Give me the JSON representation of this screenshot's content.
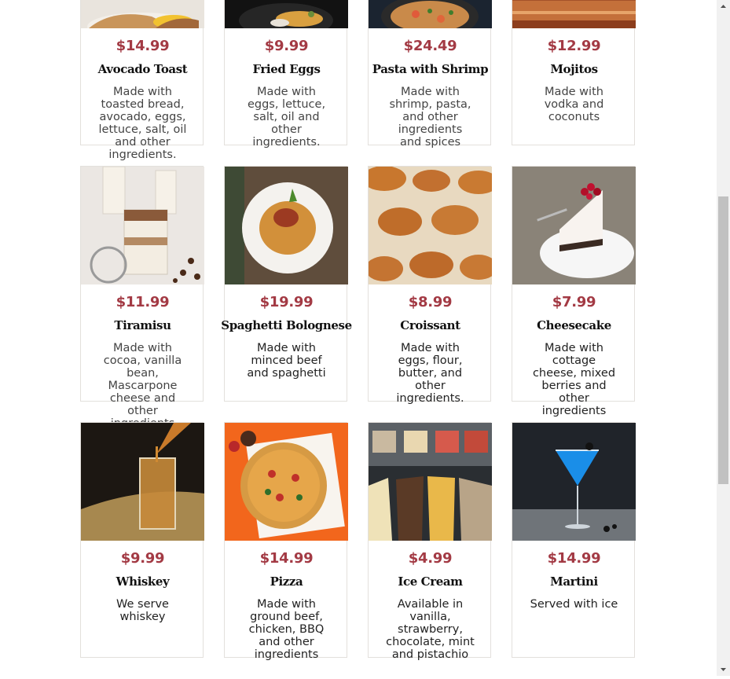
{
  "menu": {
    "items": [
      {
        "price": "$14.99",
        "name": "Avocado Toast",
        "description": "Made with toasted bread, avocado, eggs, lettuce, salt, oil and other ingredients.",
        "image": "avocado-toast-photo"
      },
      {
        "price": "$9.99",
        "name": "Fried Eggs",
        "description": "Made with eggs, lettuce, salt, oil and other ingredients.",
        "image": "fried-eggs-photo"
      },
      {
        "price": "$24.49",
        "name": "Pasta with Shrimp",
        "description": "Made with shrimp, pasta, and other ingredients and spices",
        "image": "pasta-shrimp-photo"
      },
      {
        "price": "$12.99",
        "name": "Mojitos",
        "description": "Made with vodka and coconuts",
        "image": "mojitos-photo"
      },
      {
        "price": "$11.99",
        "name": "Tiramisu",
        "description": "Made with cocoa, vanilla bean, Mascarpone cheese and other ingredients",
        "image": "tiramisu-photo"
      },
      {
        "price": "$19.99",
        "name": "Spaghetti Bolognese",
        "description": "Made with minced beef and spaghetti",
        "image": "spaghetti-photo"
      },
      {
        "price": "$8.99",
        "name": "Croissant",
        "description": "Made with eggs, flour, butter, and other ingredients.",
        "image": "croissant-photo"
      },
      {
        "price": "$7.99",
        "name": "Cheesecake",
        "description": "Made with cottage cheese, mixed berries and other ingredients",
        "image": "cheesecake-photo"
      },
      {
        "price": "$9.99",
        "name": "Whiskey",
        "description": "We serve whiskey",
        "image": "whiskey-photo"
      },
      {
        "price": "$14.99",
        "name": "Pizza",
        "description": "Made with ground beef, chicken, BBQ and other ingredients",
        "image": "pizza-photo"
      },
      {
        "price": "$4.99",
        "name": "Ice Cream",
        "description": "Available in vanilla, strawberry, chocolate, mint and pistachio",
        "image": "ice-cream-photo"
      },
      {
        "price": "$14.99",
        "name": "Martini",
        "description": "Served with ice",
        "image": "martini-photo"
      }
    ]
  },
  "colors": {
    "price": "#a33a44",
    "border": "#e3e0dc"
  },
  "scrollbar": {
    "up_icon": "arrow-up-icon",
    "down_icon": "arrow-down-icon"
  }
}
